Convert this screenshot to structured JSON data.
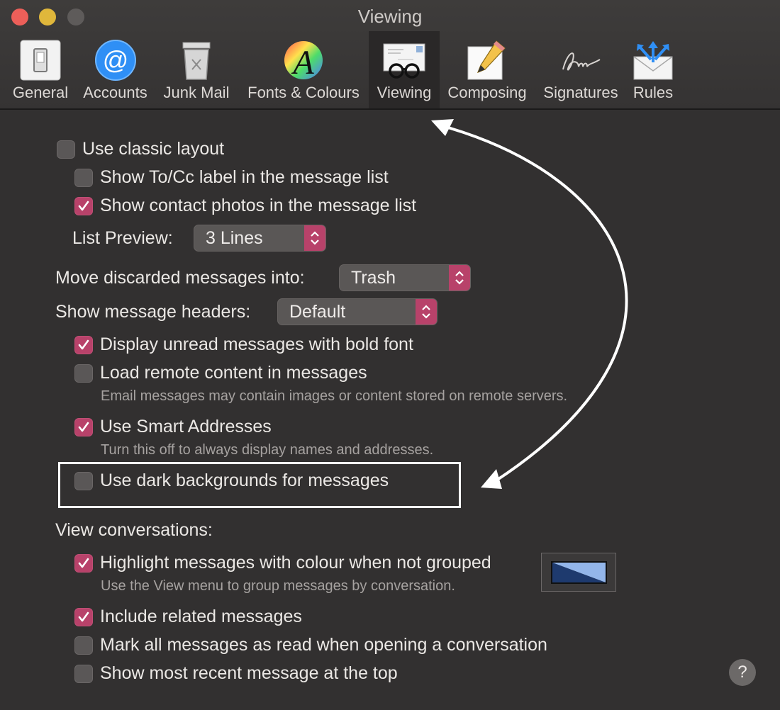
{
  "window": {
    "title": "Viewing"
  },
  "toolbar": {
    "tabs": [
      {
        "label": "General",
        "icon": "light-switch-icon"
      },
      {
        "label": "Accounts",
        "icon": "at-sign-icon"
      },
      {
        "label": "Junk Mail",
        "icon": "trash-bin-icon"
      },
      {
        "label": "Fonts & Colours",
        "icon": "font-color-wheel-icon"
      },
      {
        "label": "Viewing",
        "icon": "glasses-envelope-icon",
        "selected": true
      },
      {
        "label": "Composing",
        "icon": "pencil-note-icon"
      },
      {
        "label": "Signatures",
        "icon": "signature-icon"
      },
      {
        "label": "Rules",
        "icon": "envelope-arrows-icon"
      }
    ]
  },
  "settings": {
    "classic_layout": {
      "label": "Use classic layout",
      "checked": false
    },
    "show_tocc": {
      "label": "Show To/Cc label in the message list",
      "checked": false
    },
    "contact_photos": {
      "label": "Show contact photos in the message list",
      "checked": true
    },
    "list_preview": {
      "label": "List Preview:",
      "value": "3 Lines"
    },
    "move_discarded": {
      "label": "Move discarded messages into:",
      "value": "Trash"
    },
    "message_headers": {
      "label": "Show message headers:",
      "value": "Default"
    },
    "bold_unread": {
      "label": "Display unread messages with bold font",
      "checked": true
    },
    "remote_content": {
      "label": "Load remote content in messages",
      "checked": false,
      "hint": "Email messages may contain images or content stored on remote servers."
    },
    "smart_addresses": {
      "label": "Use Smart Addresses",
      "checked": true,
      "hint": "Turn this off to always display names and addresses."
    },
    "dark_backgrounds": {
      "label": "Use dark backgrounds for messages",
      "checked": false
    },
    "view_conversations": {
      "label": "View conversations:"
    },
    "highlight_colour": {
      "label": "Highlight messages with colour when not grouped",
      "checked": true,
      "hint": "Use the View menu to group messages by conversation.",
      "colour_top": "#93b6ea",
      "colour_bottom": "#1e3a6e"
    },
    "related_messages": {
      "label": "Include related messages",
      "checked": true
    },
    "mark_read": {
      "label": "Mark all messages as read when opening a conversation",
      "checked": false
    },
    "recent_top": {
      "label": "Show most recent message at the top",
      "checked": false
    }
  },
  "help": {
    "label": "?"
  },
  "colors": {
    "accent": "#b8426a",
    "window_bg": "#323030",
    "annotation": "#ffffff"
  }
}
